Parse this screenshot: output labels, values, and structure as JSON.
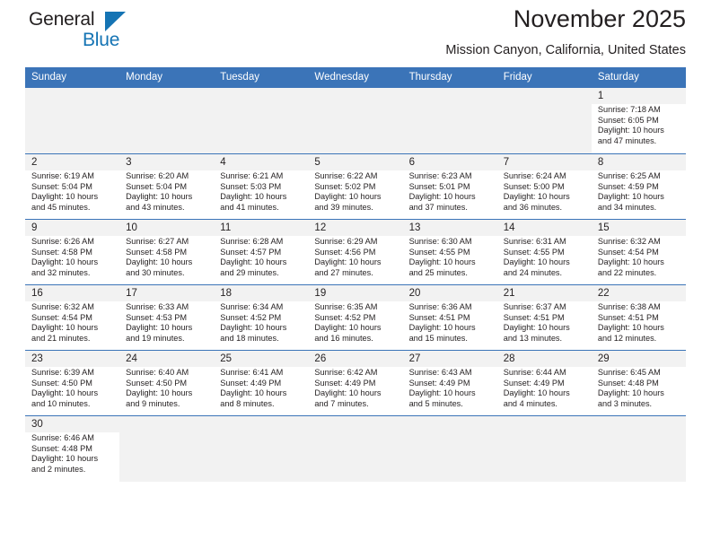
{
  "brand": {
    "name_top": "General",
    "name_bottom": "Blue",
    "accent_color": "#1574b4",
    "logo_icon": "triangle-icon"
  },
  "header": {
    "title": "November 2025",
    "subtitle": "Mission Canyon, California, United States"
  },
  "colors": {
    "header_row_background": "#3b74b8",
    "header_row_text": "#ffffff",
    "daynum_strip_background": "#f2f2f2",
    "empty_cell_background": "#f2f2f2",
    "row_separator": "#3b74b8",
    "body_text": "#231f20"
  },
  "labels": {
    "sunrise_prefix": "Sunrise:",
    "sunset_prefix": "Sunset:",
    "daylight_prefix": "Daylight:"
  },
  "weekdays": [
    "Sunday",
    "Monday",
    "Tuesday",
    "Wednesday",
    "Thursday",
    "Friday",
    "Saturday"
  ],
  "weeks": [
    [
      {
        "empty": true
      },
      {
        "empty": true
      },
      {
        "empty": true
      },
      {
        "empty": true
      },
      {
        "empty": true
      },
      {
        "empty": true
      },
      {
        "day": "1",
        "sunrise": "Sunrise: 7:18 AM",
        "sunset": "Sunset: 6:05 PM",
        "daylight_line1": "Daylight: 10 hours",
        "daylight_line2": "and 47 minutes."
      }
    ],
    [
      {
        "day": "2",
        "sunrise": "Sunrise: 6:19 AM",
        "sunset": "Sunset: 5:04 PM",
        "daylight_line1": "Daylight: 10 hours",
        "daylight_line2": "and 45 minutes."
      },
      {
        "day": "3",
        "sunrise": "Sunrise: 6:20 AM",
        "sunset": "Sunset: 5:04 PM",
        "daylight_line1": "Daylight: 10 hours",
        "daylight_line2": "and 43 minutes."
      },
      {
        "day": "4",
        "sunrise": "Sunrise: 6:21 AM",
        "sunset": "Sunset: 5:03 PM",
        "daylight_line1": "Daylight: 10 hours",
        "daylight_line2": "and 41 minutes."
      },
      {
        "day": "5",
        "sunrise": "Sunrise: 6:22 AM",
        "sunset": "Sunset: 5:02 PM",
        "daylight_line1": "Daylight: 10 hours",
        "daylight_line2": "and 39 minutes."
      },
      {
        "day": "6",
        "sunrise": "Sunrise: 6:23 AM",
        "sunset": "Sunset: 5:01 PM",
        "daylight_line1": "Daylight: 10 hours",
        "daylight_line2": "and 37 minutes."
      },
      {
        "day": "7",
        "sunrise": "Sunrise: 6:24 AM",
        "sunset": "Sunset: 5:00 PM",
        "daylight_line1": "Daylight: 10 hours",
        "daylight_line2": "and 36 minutes."
      },
      {
        "day": "8",
        "sunrise": "Sunrise: 6:25 AM",
        "sunset": "Sunset: 4:59 PM",
        "daylight_line1": "Daylight: 10 hours",
        "daylight_line2": "and 34 minutes."
      }
    ],
    [
      {
        "day": "9",
        "sunrise": "Sunrise: 6:26 AM",
        "sunset": "Sunset: 4:58 PM",
        "daylight_line1": "Daylight: 10 hours",
        "daylight_line2": "and 32 minutes."
      },
      {
        "day": "10",
        "sunrise": "Sunrise: 6:27 AM",
        "sunset": "Sunset: 4:58 PM",
        "daylight_line1": "Daylight: 10 hours",
        "daylight_line2": "and 30 minutes."
      },
      {
        "day": "11",
        "sunrise": "Sunrise: 6:28 AM",
        "sunset": "Sunset: 4:57 PM",
        "daylight_line1": "Daylight: 10 hours",
        "daylight_line2": "and 29 minutes."
      },
      {
        "day": "12",
        "sunrise": "Sunrise: 6:29 AM",
        "sunset": "Sunset: 4:56 PM",
        "daylight_line1": "Daylight: 10 hours",
        "daylight_line2": "and 27 minutes."
      },
      {
        "day": "13",
        "sunrise": "Sunrise: 6:30 AM",
        "sunset": "Sunset: 4:55 PM",
        "daylight_line1": "Daylight: 10 hours",
        "daylight_line2": "and 25 minutes."
      },
      {
        "day": "14",
        "sunrise": "Sunrise: 6:31 AM",
        "sunset": "Sunset: 4:55 PM",
        "daylight_line1": "Daylight: 10 hours",
        "daylight_line2": "and 24 minutes."
      },
      {
        "day": "15",
        "sunrise": "Sunrise: 6:32 AM",
        "sunset": "Sunset: 4:54 PM",
        "daylight_line1": "Daylight: 10 hours",
        "daylight_line2": "and 22 minutes."
      }
    ],
    [
      {
        "day": "16",
        "sunrise": "Sunrise: 6:32 AM",
        "sunset": "Sunset: 4:54 PM",
        "daylight_line1": "Daylight: 10 hours",
        "daylight_line2": "and 21 minutes."
      },
      {
        "day": "17",
        "sunrise": "Sunrise: 6:33 AM",
        "sunset": "Sunset: 4:53 PM",
        "daylight_line1": "Daylight: 10 hours",
        "daylight_line2": "and 19 minutes."
      },
      {
        "day": "18",
        "sunrise": "Sunrise: 6:34 AM",
        "sunset": "Sunset: 4:52 PM",
        "daylight_line1": "Daylight: 10 hours",
        "daylight_line2": "and 18 minutes."
      },
      {
        "day": "19",
        "sunrise": "Sunrise: 6:35 AM",
        "sunset": "Sunset: 4:52 PM",
        "daylight_line1": "Daylight: 10 hours",
        "daylight_line2": "and 16 minutes."
      },
      {
        "day": "20",
        "sunrise": "Sunrise: 6:36 AM",
        "sunset": "Sunset: 4:51 PM",
        "daylight_line1": "Daylight: 10 hours",
        "daylight_line2": "and 15 minutes."
      },
      {
        "day": "21",
        "sunrise": "Sunrise: 6:37 AM",
        "sunset": "Sunset: 4:51 PM",
        "daylight_line1": "Daylight: 10 hours",
        "daylight_line2": "and 13 minutes."
      },
      {
        "day": "22",
        "sunrise": "Sunrise: 6:38 AM",
        "sunset": "Sunset: 4:51 PM",
        "daylight_line1": "Daylight: 10 hours",
        "daylight_line2": "and 12 minutes."
      }
    ],
    [
      {
        "day": "23",
        "sunrise": "Sunrise: 6:39 AM",
        "sunset": "Sunset: 4:50 PM",
        "daylight_line1": "Daylight: 10 hours",
        "daylight_line2": "and 10 minutes."
      },
      {
        "day": "24",
        "sunrise": "Sunrise: 6:40 AM",
        "sunset": "Sunset: 4:50 PM",
        "daylight_line1": "Daylight: 10 hours",
        "daylight_line2": "and 9 minutes."
      },
      {
        "day": "25",
        "sunrise": "Sunrise: 6:41 AM",
        "sunset": "Sunset: 4:49 PM",
        "daylight_line1": "Daylight: 10 hours",
        "daylight_line2": "and 8 minutes."
      },
      {
        "day": "26",
        "sunrise": "Sunrise: 6:42 AM",
        "sunset": "Sunset: 4:49 PM",
        "daylight_line1": "Daylight: 10 hours",
        "daylight_line2": "and 7 minutes."
      },
      {
        "day": "27",
        "sunrise": "Sunrise: 6:43 AM",
        "sunset": "Sunset: 4:49 PM",
        "daylight_line1": "Daylight: 10 hours",
        "daylight_line2": "and 5 minutes."
      },
      {
        "day": "28",
        "sunrise": "Sunrise: 6:44 AM",
        "sunset": "Sunset: 4:49 PM",
        "daylight_line1": "Daylight: 10 hours",
        "daylight_line2": "and 4 minutes."
      },
      {
        "day": "29",
        "sunrise": "Sunrise: 6:45 AM",
        "sunset": "Sunset: 4:48 PM",
        "daylight_line1": "Daylight: 10 hours",
        "daylight_line2": "and 3 minutes."
      }
    ],
    [
      {
        "day": "30",
        "sunrise": "Sunrise: 6:46 AM",
        "sunset": "Sunset: 4:48 PM",
        "daylight_line1": "Daylight: 10 hours",
        "daylight_line2": "and 2 minutes."
      },
      {
        "empty": true
      },
      {
        "empty": true
      },
      {
        "empty": true
      },
      {
        "empty": true
      },
      {
        "empty": true
      },
      {
        "empty": true
      }
    ]
  ]
}
